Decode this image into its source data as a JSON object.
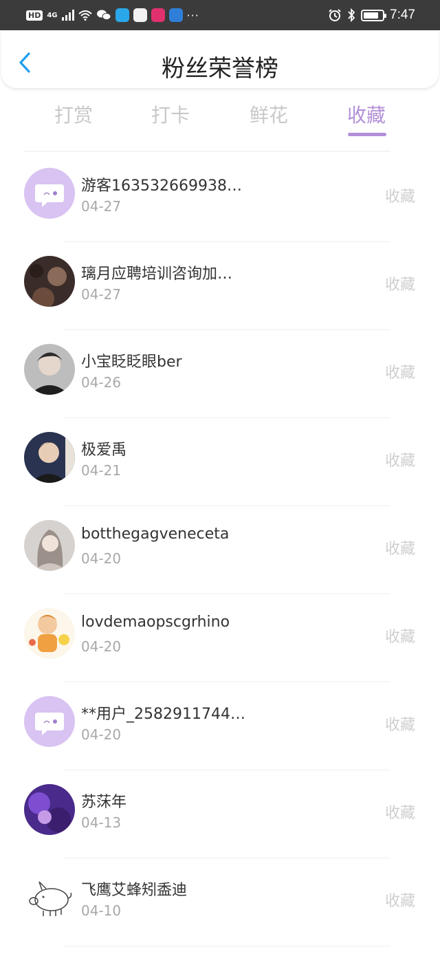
{
  "status_bar": {
    "network_badge": "HD",
    "network_type": "4G",
    "time": "7:47",
    "dots": "···",
    "battery_level": 0.8
  },
  "header": {
    "title": "粉丝荣誉榜",
    "back_icon": "chevron-left-icon"
  },
  "tabs": [
    {
      "label": "打赏",
      "active": false
    },
    {
      "label": "打卡",
      "active": false
    },
    {
      "label": "鲜花",
      "active": false
    },
    {
      "label": "收藏",
      "active": true
    }
  ],
  "colors": {
    "accent": "#b28fd8",
    "back_icon": "#1e9ff0",
    "status_bar_bg": "#3b3b3b",
    "muted_text": "#a8a8a8",
    "action_text": "#cfcfcf"
  },
  "rows": [
    {
      "name": "游客163532669938…",
      "date": "04-27",
      "action": "收藏",
      "avatar": "default-chat-avatar"
    },
    {
      "name": "璃月应聘培训咨询加…",
      "date": "04-27",
      "action": "收藏",
      "avatar": "photo-avatar"
    },
    {
      "name": "小宝眨眨眼ber",
      "date": "04-26",
      "action": "收藏",
      "avatar": "photo-avatar"
    },
    {
      "name": "极爱禹",
      "date": "04-21",
      "action": "收藏",
      "avatar": "photo-avatar"
    },
    {
      "name": "botthegagveneceta",
      "date": "04-20",
      "action": "收藏",
      "avatar": "photo-avatar"
    },
    {
      "name": "lovdemaopscgrhino",
      "date": "04-20",
      "action": "收藏",
      "avatar": "cartoon-avatar"
    },
    {
      "name": "**用户_2582911744…",
      "date": "04-20",
      "action": "收藏",
      "avatar": "default-chat-avatar"
    },
    {
      "name": "苏莯年",
      "date": "04-13",
      "action": "收藏",
      "avatar": "photo-avatar"
    },
    {
      "name": "飞鹰艾蜂矧盉迪",
      "date": "04-10",
      "action": "收藏",
      "avatar": "pig-sketch-avatar"
    }
  ]
}
